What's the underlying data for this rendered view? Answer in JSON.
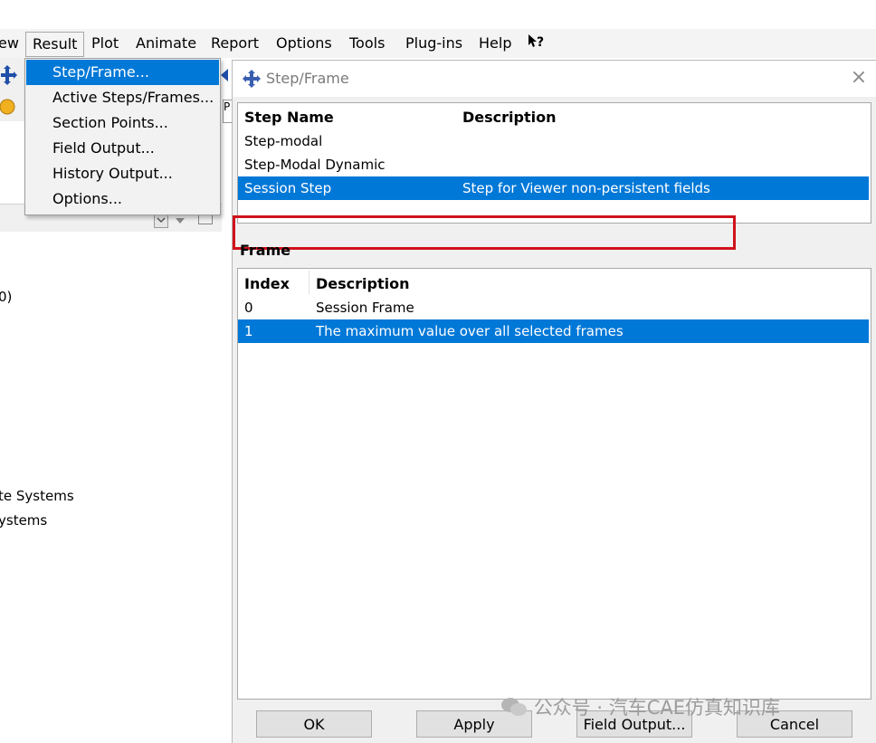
{
  "menubar": {
    "items": [
      {
        "label": "ew"
      },
      {
        "label": "Result"
      },
      {
        "label": "Plot"
      },
      {
        "label": "Animate"
      },
      {
        "label": "Report"
      },
      {
        "label": "Options"
      },
      {
        "label": "Tools"
      },
      {
        "label": "Plug-ins"
      },
      {
        "label": "Help"
      },
      {
        "label": "?"
      }
    ]
  },
  "result_menu": {
    "items": [
      {
        "label": "Step/Frame..."
      },
      {
        "label": "Active Steps/Frames..."
      },
      {
        "label": "Section Points..."
      },
      {
        "label": "Field Output..."
      },
      {
        "label": "History Output..."
      },
      {
        "label": "Options..."
      }
    ]
  },
  "left_panel": {
    "tree": [
      {
        "label": "0)"
      },
      {
        "label": "te Systems"
      },
      {
        "label": "ystems"
      }
    ],
    "partial_tab": "P"
  },
  "dialog": {
    "title": "Step/Frame",
    "close_glyph": "×",
    "step_table": {
      "headers": [
        "Step Name",
        "Description"
      ],
      "rows": [
        {
          "name": "Step-modal",
          "description": ""
        },
        {
          "name": "Step-Modal Dynamic",
          "description": ""
        },
        {
          "name": "Session Step",
          "description": "Step for Viewer non-persistent fields",
          "selected": true
        }
      ]
    },
    "frame_label": "Frame",
    "frame_table": {
      "headers": [
        "Index",
        "Description"
      ],
      "rows": [
        {
          "index": "0",
          "description": "Session Frame"
        },
        {
          "index": "1",
          "description": "The maximum value over all selected frames",
          "selected": true
        }
      ]
    },
    "buttons": {
      "ok": "OK",
      "apply": "Apply",
      "field_output": "Field Output...",
      "cancel": "Cancel"
    }
  },
  "watermark": "公众号 · 汽车CAE仿真知识库",
  "colors": {
    "selection": "#0078d7",
    "highlight_border": "#d0121b"
  }
}
